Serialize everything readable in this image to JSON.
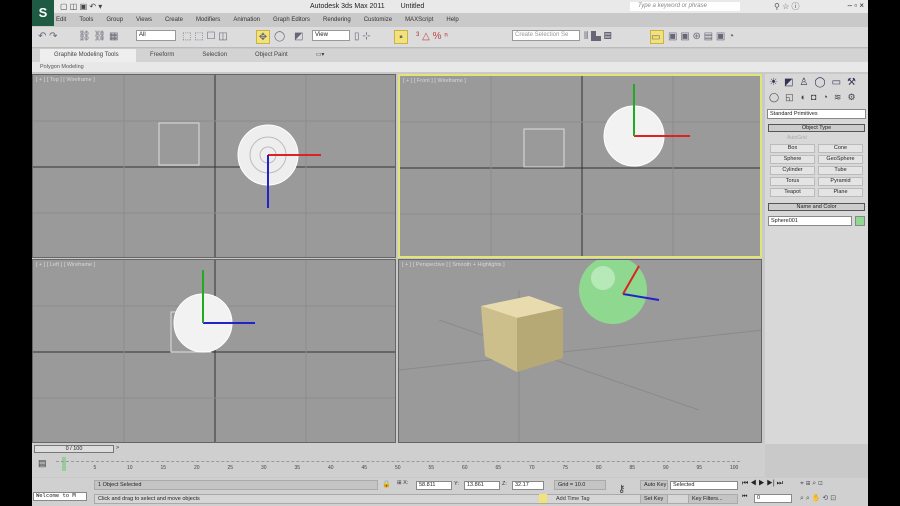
{
  "window": {
    "app_title": "Autodesk 3ds Max  2011",
    "doc_title": "Untitled",
    "search_placeholder": "Type a keyword or phrase",
    "logo": "S"
  },
  "menu": [
    "Edit",
    "Tools",
    "Group",
    "Views",
    "Create",
    "Modifiers",
    "Animation",
    "Graph Editors",
    "Rendering",
    "Customize",
    "MAXScript",
    "Help"
  ],
  "toolbar": {
    "selection_filter": "All",
    "ref_coord": "View",
    "named_selection": "Create Selection Se"
  },
  "ribbon": {
    "tabs": [
      "Graphite Modeling Tools",
      "Freeform",
      "Selection",
      "Object Paint"
    ],
    "panel": "Polygon Modeling"
  },
  "viewports": [
    {
      "label": "[ + ] [ Top ] [ Wireframe ]"
    },
    {
      "label": "[ + ] [ Front ] [ Wireframe ]"
    },
    {
      "label": "[ + ] [ Left ] [ Wireframe ]"
    },
    {
      "label": "[ + ] [ Perspective ] [ Smooth + Highlights ]"
    }
  ],
  "command_panel": {
    "category": "Standard Primitives",
    "object_type_title": "Object Type",
    "autogrid": "AutoGrid",
    "buttons": [
      "Box",
      "Cone",
      "Sphere",
      "GeoSphere",
      "Cylinder",
      "Tube",
      "Torus",
      "Pyramid",
      "Teapot",
      "Plane"
    ],
    "name_color_title": "Name and Color",
    "object_name": "Sphere001",
    "color": "#8fd88f"
  },
  "timeline": {
    "frame": "0 / 100",
    "ticks": [
      "5",
      "10",
      "15",
      "20",
      "25",
      "30",
      "35",
      "40",
      "45",
      "50",
      "55",
      "60",
      "65",
      "70",
      "75",
      "80",
      "85",
      "90",
      "95",
      "100"
    ]
  },
  "status": {
    "maxscript": "Welcome to M",
    "selected": "1 Object Selected",
    "prompt": "Click and drag to select and move objects",
    "x": "58.811",
    "y": "13.861",
    "z": "32.17",
    "grid": "Grid = 10.0",
    "add_time_tag": "Add Time Tag",
    "auto_key": "Auto Key",
    "set_key": "Set Key",
    "key_mode": "Selected",
    "key_filters": "Key Filters...",
    "current_frame": "0"
  }
}
